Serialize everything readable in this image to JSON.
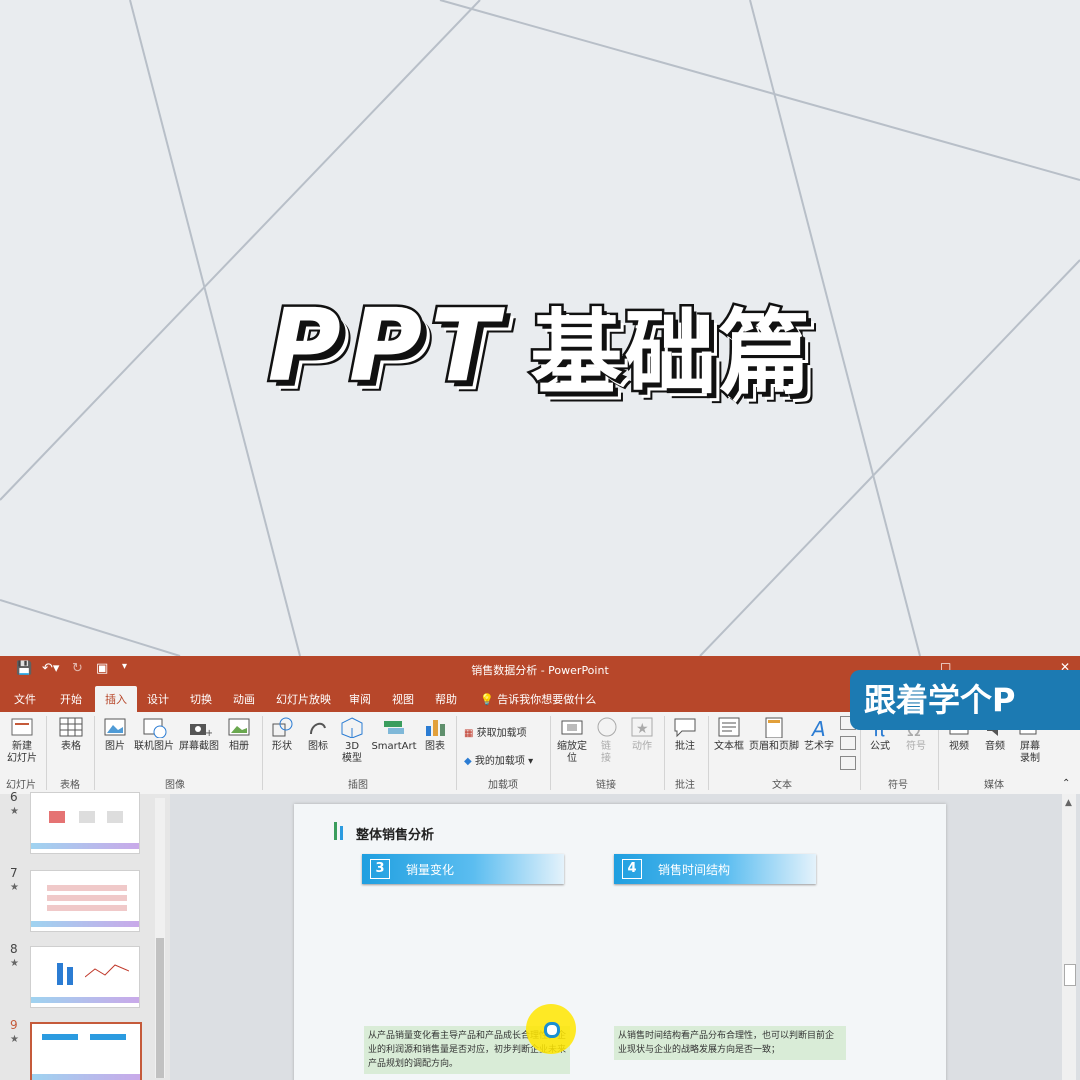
{
  "overlay": {
    "title_latin": "PPT",
    "title_cjk": "基础篇",
    "watermark": "跟着学个P"
  },
  "window": {
    "title": "销售数据分析 - PowerPoint"
  },
  "menu": {
    "tabs": [
      "文件",
      "开始",
      "插入",
      "设计",
      "切换",
      "动画",
      "幻灯片放映",
      "审阅",
      "视图",
      "帮助"
    ],
    "active": "插入",
    "tellme": "告诉我你想要做什么"
  },
  "ribbon": {
    "new_slide": "新建\n幻灯片",
    "table": "表格",
    "picture": "图片",
    "online_picture": "联机图片",
    "screenshot": "屏幕截图",
    "album": "相册",
    "shapes": "形状",
    "icons": "图标",
    "model_3d": "3D\n模型",
    "smartart": "SmartArt",
    "chart": "图表",
    "get_addins": "获取加载项",
    "my_addins": "我的加载项",
    "zoom": "缩放定\n位",
    "link": "链\n接",
    "action": "动作",
    "comment": "批注",
    "textbox": "文本框",
    "header_footer": "页眉和页脚",
    "wordart": "艺术字",
    "equation": "公式",
    "symbol": "符号",
    "video": "视频",
    "audio": "音频",
    "screen_record": "屏幕\n录制",
    "groups": {
      "slides": "幻灯片",
      "tables": "表格",
      "images": "图像",
      "illustrations": "插图",
      "addins": "加载项",
      "links": "链接",
      "comments": "批注",
      "text": "文本",
      "symbols": "符号",
      "media": "媒体"
    }
  },
  "thumbnails": [
    {
      "num": "6",
      "star": "★"
    },
    {
      "num": "7",
      "star": "★"
    },
    {
      "num": "8",
      "star": "★"
    },
    {
      "num": "9",
      "star": "★",
      "selected": true
    }
  ],
  "slide": {
    "title": "整体销售分析",
    "sections": [
      {
        "num": "3",
        "label": "销量变化"
      },
      {
        "num": "4",
        "label": "销售时间结构"
      }
    ],
    "desc_left": "从产品销量变化看主导产品和产品成长合理性，企业的利润源和销售量是否对应，初步判断企业未来产品规划的调配方向。",
    "desc_right": "从销售时间结构看产品分布合理性，也可以判断目前企业现状与企业的战略发展方向是否一致；"
  }
}
